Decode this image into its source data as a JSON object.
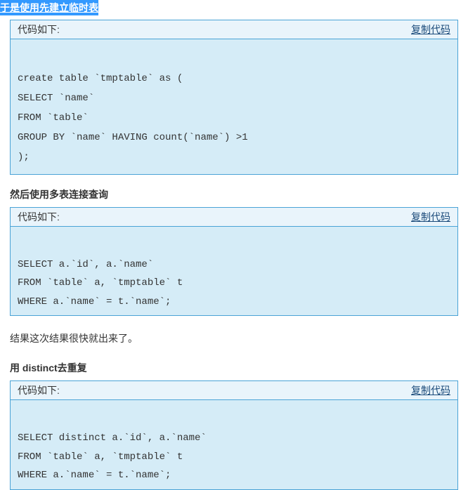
{
  "headings": {
    "highlight": "于是使用先建立临时表",
    "section2": "然后使用多表连接查询",
    "section3": "用 distinct去重复"
  },
  "result_text": "结果这次结果很快就出来了。",
  "blocks": {
    "label": "代码如下:",
    "copy": "复制代码",
    "code1": "\ncreate table `tmptable` as (\nSELECT `name`\nFROM `table`\nGROUP BY `name` HAVING count(`name`) >1\n);",
    "code2": "\nSELECT a.`id`, a.`name`\nFROM `table` a, `tmptable` t\nWHERE a.`name` = t.`name`;",
    "code3": "\nSELECT distinct a.`id`, a.`name`\nFROM `table` a, `tmptable` t\nWHERE a.`name` = t.`name`;"
  }
}
